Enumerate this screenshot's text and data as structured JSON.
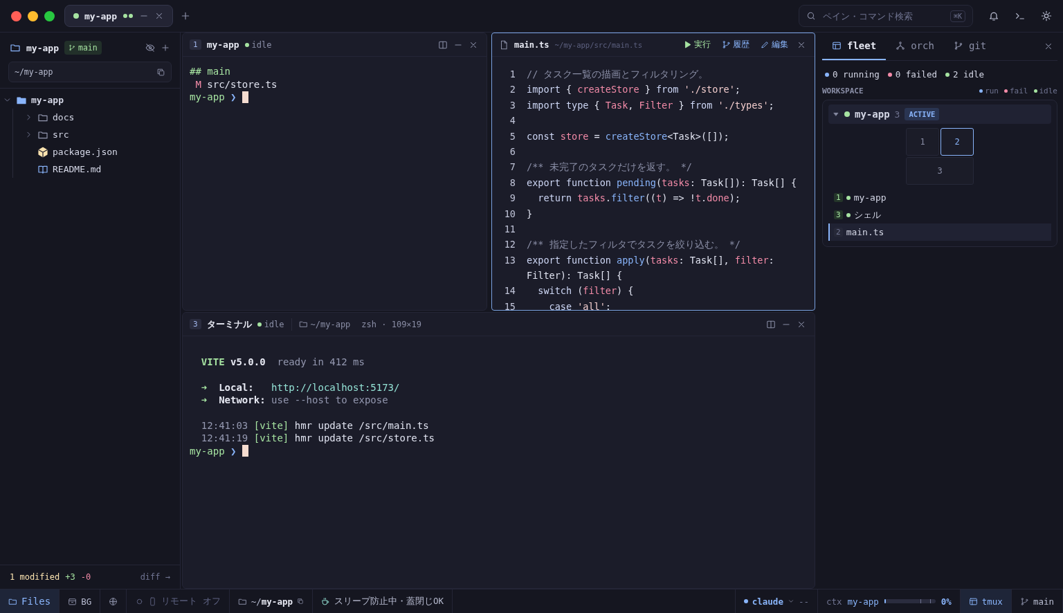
{
  "titlebar": {
    "tabs": [
      {
        "label": "my-app",
        "selected": true,
        "color": "#a6e3a1"
      }
    ],
    "search": {
      "placeholder": "ペイン・コマンド検索",
      "shortcut": "⌘K"
    }
  },
  "sidebar": {
    "project": "my-app",
    "branch": "main",
    "path": "~/my-app",
    "tree": [
      {
        "name": "my-app",
        "kind": "folder",
        "expanded": true,
        "children": [
          {
            "name": "docs",
            "kind": "folder",
            "expanded": false
          },
          {
            "name": "src",
            "kind": "folder",
            "expanded": false
          },
          {
            "name": "package.json",
            "kind": "package"
          },
          {
            "name": "README.md",
            "kind": "book"
          }
        ]
      }
    ],
    "footer": {
      "modified": "1 modified",
      "added": "+3",
      "removed": "-0",
      "link": "diff →"
    }
  },
  "shell_pane": {
    "index": "1",
    "title": "my-app",
    "status": "idle",
    "lines": [
      {
        "tokens": [
          {
            "kind": "green",
            "text": "## main"
          }
        ]
      },
      {
        "tokens": [
          {
            "kind": "pink",
            "text": " M"
          },
          {
            "kind": "plain",
            "text": " src/store.ts"
          }
        ]
      },
      {
        "tokens": [
          {
            "kind": "green",
            "text": "my-app"
          },
          {
            "kind": "blue",
            "text": " ❯"
          }
        ],
        "cursor": true
      }
    ]
  },
  "editor": {
    "file": "main.ts",
    "path": "~/my-app/src/main.ts",
    "actions": [
      {
        "label": "実行",
        "kind": "run"
      },
      {
        "label": "履歴",
        "kind": "history"
      },
      {
        "label": "編集",
        "kind": "edit"
      }
    ],
    "lines": [
      {
        "number": "1",
        "tokens": [
          {
            "kind": "comment",
            "text": "// タスク一覧の描画とフィルタリング。"
          }
        ]
      },
      {
        "number": "2",
        "tokens": [
          {
            "kind": "kw",
            "text": "import"
          },
          {
            "kind": "plain",
            "text": " { "
          },
          {
            "kind": "var",
            "text": "createStore"
          },
          {
            "kind": "plain",
            "text": " } "
          },
          {
            "kind": "kw",
            "text": "from"
          },
          {
            "kind": "str",
            "text": " './store'"
          },
          {
            "kind": "plain",
            "text": ";"
          }
        ]
      },
      {
        "number": "3",
        "tokens": [
          {
            "kind": "kw",
            "text": "import type"
          },
          {
            "kind": "plain",
            "text": " { "
          },
          {
            "kind": "var",
            "text": "Task"
          },
          {
            "kind": "plain",
            "text": ", "
          },
          {
            "kind": "var",
            "text": "Filter"
          },
          {
            "kind": "plain",
            "text": " } "
          },
          {
            "kind": "kw",
            "text": "from"
          },
          {
            "kind": "str",
            "text": " './types'"
          },
          {
            "kind": "plain",
            "text": ";"
          }
        ]
      },
      {
        "number": "4"
      },
      {
        "number": "5",
        "tokens": [
          {
            "kind": "kw",
            "text": "const"
          },
          {
            "kind": "var",
            "text": " store"
          },
          {
            "kind": "plain",
            "text": " = "
          },
          {
            "kind": "fn",
            "text": "createStore"
          },
          {
            "kind": "plain",
            "text": "<Task>([]);"
          }
        ]
      },
      {
        "number": "6"
      },
      {
        "number": "7",
        "tokens": [
          {
            "kind": "comment",
            "text": "/** 未完了のタスクだけを返す。 */"
          }
        ]
      },
      {
        "number": "8",
        "tokens": [
          {
            "kind": "kw",
            "text": "export function"
          },
          {
            "kind": "fn",
            "text": " pending"
          },
          {
            "kind": "plain",
            "text": "("
          },
          {
            "kind": "var",
            "text": "tasks"
          },
          {
            "kind": "plain",
            "text": ": Task[]): Task[] {"
          }
        ]
      },
      {
        "number": "9",
        "tokens": [
          {
            "kind": "kw",
            "text": "  return"
          },
          {
            "kind": "var",
            "text": " tasks"
          },
          {
            "kind": "plain",
            "text": "."
          },
          {
            "kind": "fn",
            "text": "filter"
          },
          {
            "kind": "plain",
            "text": "(("
          },
          {
            "kind": "var",
            "text": "t"
          },
          {
            "kind": "plain",
            "text": ") => !"
          },
          {
            "kind": "var",
            "text": "t"
          },
          {
            "kind": "plain",
            "text": "."
          },
          {
            "kind": "var",
            "text": "done"
          },
          {
            "kind": "plain",
            "text": ");"
          }
        ]
      },
      {
        "number": "10",
        "tokens": [
          {
            "kind": "plain",
            "text": "}"
          }
        ]
      },
      {
        "number": "11"
      },
      {
        "number": "12",
        "tokens": [
          {
            "kind": "comment",
            "text": "/** 指定したフィルタでタスクを絞り込む。 */"
          }
        ]
      },
      {
        "number": "13",
        "tokens": [
          {
            "kind": "kw",
            "text": "export function"
          },
          {
            "kind": "fn",
            "text": " apply"
          },
          {
            "kind": "plain",
            "text": "("
          },
          {
            "kind": "var",
            "text": "tasks"
          },
          {
            "kind": "plain",
            "text": ": Task[], "
          },
          {
            "kind": "var",
            "text": "filter"
          },
          {
            "kind": "plain",
            "text": ":"
          }
        ]
      },
      {
        "tokens": [
          {
            "kind": "plain",
            "text": "Filter): Task[] {"
          }
        ]
      },
      {
        "number": "14",
        "tokens": [
          {
            "kind": "kw",
            "text": "  switch"
          },
          {
            "kind": "plain",
            "text": " ("
          },
          {
            "kind": "var",
            "text": "filter"
          },
          {
            "kind": "plain",
            "text": ") {"
          }
        ]
      },
      {
        "number": "15",
        "tokens": [
          {
            "kind": "kw",
            "text": "    case"
          },
          {
            "kind": "str",
            "text": " 'all'"
          },
          {
            "kind": "plain",
            "text": ":"
          }
        ]
      }
    ]
  },
  "terminal": {
    "index": "3",
    "title": "ターミナル",
    "status": "idle",
    "cwd": "~/my-app",
    "info": "zsh · 109×19",
    "blocks": [
      {
        "lines": [
          {
            "tokens": [
              {
                "kind": "greenbold",
                "text": "  VITE"
              },
              {
                "kind": "bold",
                "text": " v5.0.0"
              },
              {
                "kind": "dim",
                "text": "  ready in 412 ms"
              }
            ]
          }
        ]
      },
      {
        "lines": [
          {
            "tokens": [
              {
                "kind": "green",
                "text": "  ➜"
              },
              {
                "kind": "bold",
                "text": "  Local:"
              },
              {
                "kind": "cyan",
                "text": "   http://localhost:5173/"
              }
            ]
          },
          {
            "tokens": [
              {
                "kind": "green",
                "text": "  ➜"
              },
              {
                "kind": "bold",
                "text": "  Network:"
              },
              {
                "kind": "dim",
                "text": " use --host to expose"
              }
            ]
          }
        ]
      },
      {
        "lines": [
          {
            "tokens": [
              {
                "kind": "dim",
                "text": "  12:41:03"
              },
              {
                "kind": "green",
                "text": " [vite]"
              },
              {
                "kind": "plain",
                "text": " hmr update /src/main.ts"
              }
            ]
          },
          {
            "tokens": [
              {
                "kind": "dim",
                "text": "  12:41:19"
              },
              {
                "kind": "green",
                "text": " [vite]"
              },
              {
                "kind": "plain",
                "text": " hmr update /src/store.ts"
              }
            ]
          },
          {
            "tokens": [
              {
                "kind": "green",
                "text": "my-app"
              },
              {
                "kind": "blue",
                "text": " ❯"
              }
            ],
            "cursor": true
          }
        ]
      }
    ]
  },
  "fleet": {
    "tabs": [
      {
        "label": "fleet",
        "selected": true
      },
      {
        "label": "orch",
        "selected": false
      },
      {
        "label": "git",
        "selected": false
      }
    ],
    "counts": [
      {
        "text": "0 running",
        "color": "#89b4fa"
      },
      {
        "text": "0 failed",
        "color": "#f38ba8"
      },
      {
        "text": "2 idle",
        "color": "#a6e3a1"
      }
    ],
    "section": "WORKSPACE",
    "legend": [
      {
        "text": "run",
        "color": "#89b4fa"
      },
      {
        "text": "fail",
        "color": "#f38ba8"
      },
      {
        "text": "idle",
        "color": "#a6e3a1"
      }
    ],
    "workspace": {
      "name": "my-app",
      "color": "#a6e3a1",
      "count": "3",
      "badge": "ACTIVE",
      "expanded": true,
      "panes": [
        {
          "label": "1",
          "selected": false
        },
        {
          "label": "2",
          "selected": true
        },
        {
          "label": "3",
          "selected": false
        }
      ],
      "items": [
        {
          "index": "1",
          "name": "my-app",
          "color": "#a6e3a1",
          "selected": false
        },
        {
          "index": "3",
          "name": "シェル",
          "color": "#a6e3a1",
          "selected": false
        },
        {
          "index": "2",
          "name": "main.ts",
          "selected": true
        }
      ]
    }
  },
  "status_bar": {
    "left": [
      {
        "kind": "files",
        "label": "Files",
        "selected": true
      },
      {
        "kind": "bg",
        "label": "BG",
        "selected": false
      },
      {
        "kind": "globe",
        "selected": false
      },
      {
        "kind": "remote",
        "label": "リモート オフ",
        "selected": false
      },
      {
        "kind": "folder",
        "prefix": "~/",
        "label": "my-app",
        "selected": false
      },
      {
        "kind": "sleep",
        "label": "スリープ防止中・蓋閉じOK",
        "selected": false
      }
    ],
    "agent": {
      "name": "claude",
      "extra": "--"
    },
    "ctx": {
      "label": "ctx",
      "name": "my-app",
      "level": 0,
      "reading": "0%"
    },
    "right": [
      {
        "kind": "tmux",
        "label": "tmux",
        "selected": true
      },
      {
        "kind": "branch",
        "label": "main",
        "selected": false
      }
    ]
  }
}
